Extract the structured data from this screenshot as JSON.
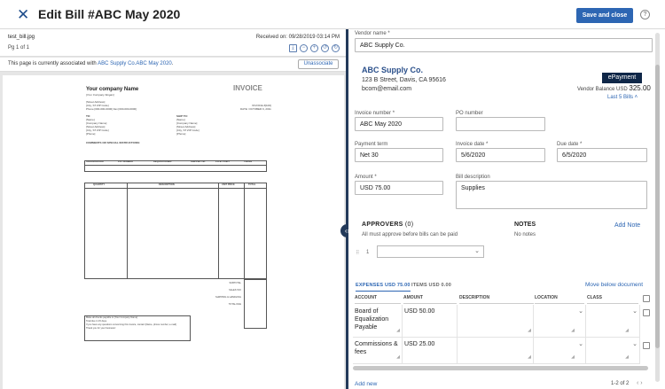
{
  "header": {
    "title": "Edit Bill #ABC May 2020",
    "save_label": "Save and close",
    "help_glyph": "?"
  },
  "document": {
    "filename": "test_bill.jpg",
    "page_label": "Pg 1 of 1",
    "received": "Received on: 09/28/2019 03:14 PM",
    "assoc_text": "This page is currently associated with",
    "assoc_link": "ABC Supply Co.ABC May 2020",
    "assoc_suffix": ".",
    "unassociate_label": "Unassociate"
  },
  "invoice_image": {
    "company": "Your company Name",
    "slogan": "[Your Company Slogan]",
    "heading": "INVOICE",
    "address_lines": [
      "[Street Address]",
      "[City, ST  ZIP Code]",
      "Phone [000-000-0000]  Fax [000-000-0000]"
    ],
    "invoice_no": "INVOICE #[100]",
    "date": "DATE: OCTOBER 9, 2011",
    "to_label": "TO:",
    "to_lines": [
      "[Name]",
      "[Company Name]",
      "[Street Address]",
      "[City, ST  ZIP Code]",
      "[Phone]"
    ],
    "ship_label": "SHIP TO:",
    "ship_lines": [
      "[Name]",
      "[Company Name]",
      "[Street Address]",
      "[City, ST  ZIP Code]",
      "[Phone]"
    ],
    "comments": "COMMENTS OR SPECIAL INSTRUCTIONS:",
    "top_headers": [
      "SALESPERSON",
      "P.O. NUMBER",
      "REQUISITIONER",
      "SHIPPED VIA",
      "F.O.B. POINT",
      "TERMS"
    ],
    "item_headers": [
      "QUANTITY",
      "DESCRIPTION",
      "UNIT PRICE",
      "TOTAL"
    ],
    "totals": [
      "SUBTOTAL",
      "SALES TAX",
      "SHIPPING & HANDLING",
      "TOTAL DUE"
    ],
    "footer_lines": [
      "Make all checks payable to [Your Company Name]",
      "Total due in 15 days.",
      "If you have any questions concerning this invoice, contact [Name, phone number, e-mail]",
      "",
      "Thank you for your business!"
    ]
  },
  "form": {
    "vendor_label": "Vendor name *",
    "vendor_value": "ABC Supply Co.",
    "vendor_display": "ABC Supply Co.",
    "vendor_address": "123 B Street, Davis, CA 95616",
    "vendor_email": "bcom@email.com",
    "epayment": "ePayment",
    "balance_label": "Vendor Balance USD",
    "balance_value": "325.00",
    "last5": "Last 5 Bills  ˄",
    "invoice_number_label": "Invoice number *",
    "invoice_number_value": "ABC May 2020",
    "po_label": "PO number",
    "po_value": "",
    "term_label": "Payment term",
    "term_value": "Net 30",
    "invoice_date_label": "Invoice date *",
    "invoice_date_value": "5/6/2020",
    "due_date_label": "Due date *",
    "due_date_value": "6/5/2020",
    "amount_label": "Amount *",
    "amount_value": "USD 75.00",
    "bill_desc_label": "Bill description",
    "bill_desc_value": "Supplies"
  },
  "approvers": {
    "title": "APPROVERS",
    "count": "(0)",
    "note": "All must approve before bills can be paid",
    "row_number": "1"
  },
  "notes": {
    "title": "NOTES",
    "empty": "No notes",
    "add_label": "Add Note"
  },
  "expenses": {
    "tab_expenses": "EXPENSES USD 75.00",
    "tab_items": "ITEMS USD 0.00",
    "move_below": "Move below document",
    "columns": [
      "ACCOUNT",
      "AMOUNT",
      "DESCRIPTION",
      "LOCATION",
      "CLASS"
    ],
    "rows": [
      {
        "account": "Board of Equalization Payable",
        "amount": "USD 50.00"
      },
      {
        "account": "Commissions & fees",
        "amount": "USD 25.00"
      }
    ],
    "add_new": "Add new",
    "pager": "1-2 of 2"
  }
}
